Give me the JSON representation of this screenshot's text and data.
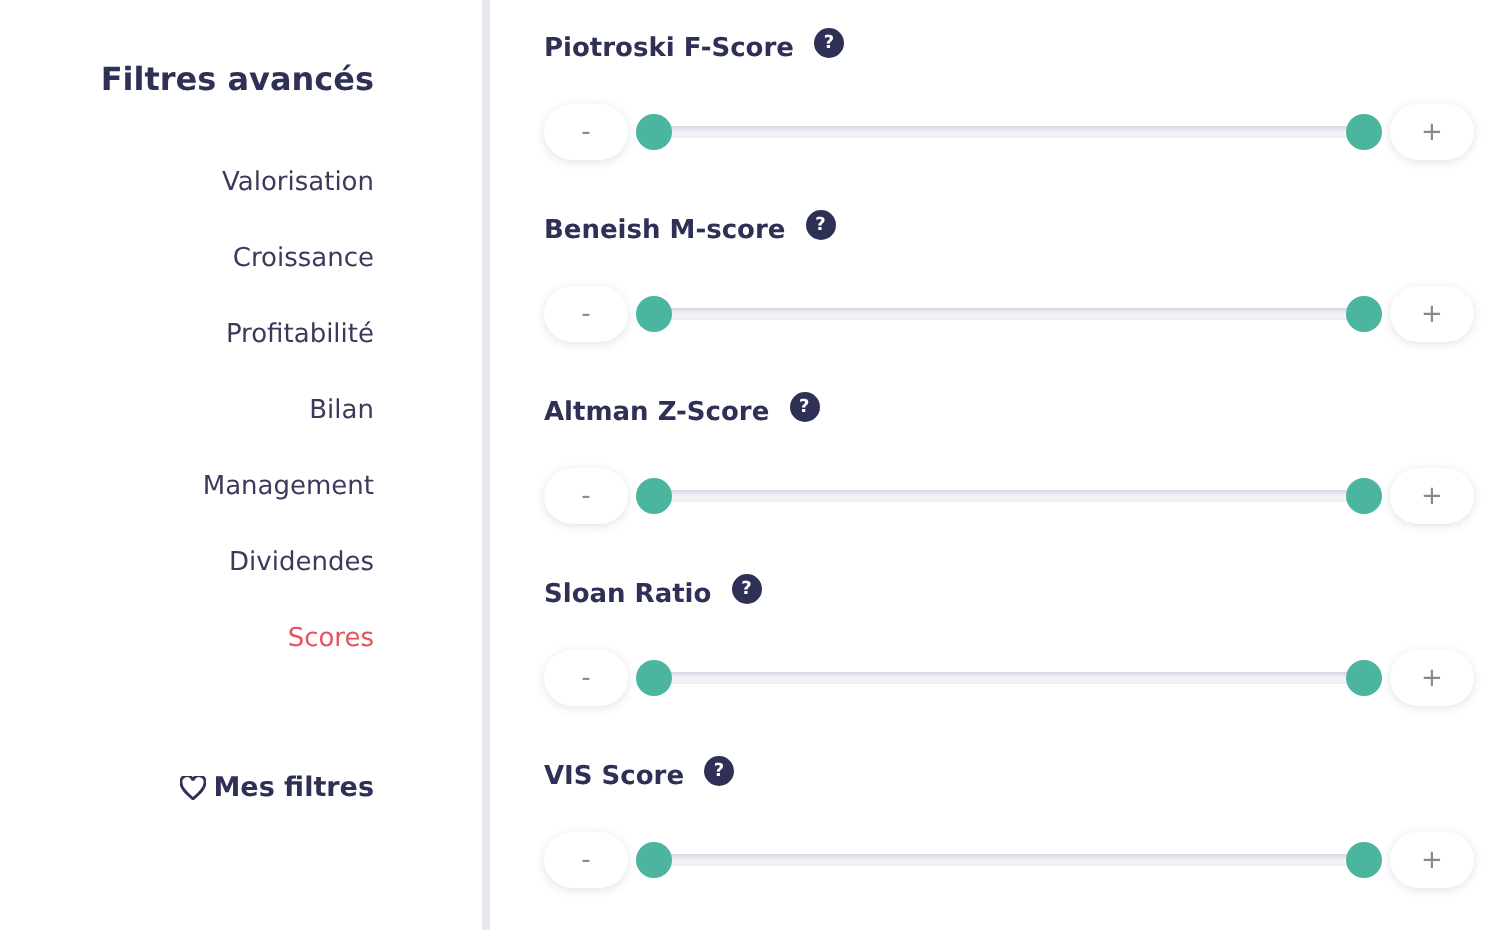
{
  "sidebar": {
    "title": "Filtres avancés",
    "items": [
      {
        "label": "Valorisation",
        "selected": false
      },
      {
        "label": "Croissance",
        "selected": false
      },
      {
        "label": "Profitabilité",
        "selected": false
      },
      {
        "label": "Bilan",
        "selected": false
      },
      {
        "label": "Management",
        "selected": false
      },
      {
        "label": "Dividendes",
        "selected": false
      },
      {
        "label": "Scores",
        "selected": true
      }
    ],
    "favorites": "Mes filtres"
  },
  "filters": [
    {
      "label": "Piotroski F-Score",
      "help": "?",
      "minus": "-",
      "plus": "+",
      "low": {
        "level": 0
      },
      "high": {
        "level": 1
      }
    },
    {
      "label": "Beneish M-score",
      "help": "?",
      "minus": "-",
      "plus": "+",
      "low": {
        "level": 0
      },
      "high": {
        "level": 1
      }
    },
    {
      "label": "Altman Z-Score",
      "help": "?",
      "minus": "-",
      "plus": "+",
      "low": {
        "level": 0
      },
      "high": {
        "level": 1
      }
    },
    {
      "label": "Sloan Ratio",
      "help": "?",
      "minus": "-",
      "plus": "+",
      "low": {
        "level": 0
      },
      "high": {
        "level": 1
      }
    },
    {
      "label": "VIS Score",
      "help": "?",
      "minus": "-",
      "plus": "+",
      "low": {
        "level": 0
      },
      "high": {
        "level": 1
      }
    }
  ]
}
